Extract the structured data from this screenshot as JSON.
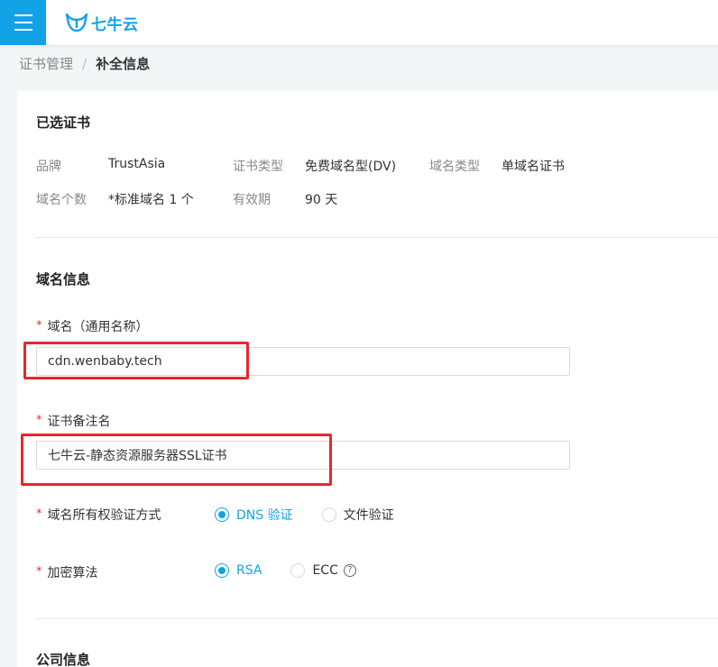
{
  "app": {
    "logo_text": "七牛云",
    "brand_color": "#11a3e6"
  },
  "breadcrumb": {
    "parent": "证书管理",
    "separator": "/",
    "current": "补全信息"
  },
  "selected_cert": {
    "title": "已选证书",
    "brand_label": "品牌",
    "brand_value": "TrustAsia",
    "type_label": "证书类型",
    "type_value": "免费域名型(DV)",
    "domain_type_label": "域名类型",
    "domain_type_value": "单域名证书",
    "count_label": "域名个数",
    "count_value": "*标准域名 1 个",
    "validity_label": "有效期",
    "validity_value": "90 天"
  },
  "domain_info": {
    "title": "域名信息",
    "required_mark": "*",
    "domain_label": "域名（通用名称）",
    "domain_value": "cdn.wenbaby.tech",
    "remark_label": "证书备注名",
    "remark_value": "七牛云-静态资源服务器SSL证书",
    "verify_label": "域名所有权验证方式",
    "verify_options": [
      {
        "label": "DNS 验证",
        "selected": true
      },
      {
        "label": "文件验证",
        "selected": false
      }
    ],
    "algo_label": "加密算法",
    "algo_options": [
      {
        "label": "RSA",
        "selected": true
      },
      {
        "label": "ECC",
        "selected": false
      }
    ],
    "help_glyph": "?"
  },
  "company_info": {
    "title": "公司信息"
  },
  "highlight_color": "#e8262c"
}
